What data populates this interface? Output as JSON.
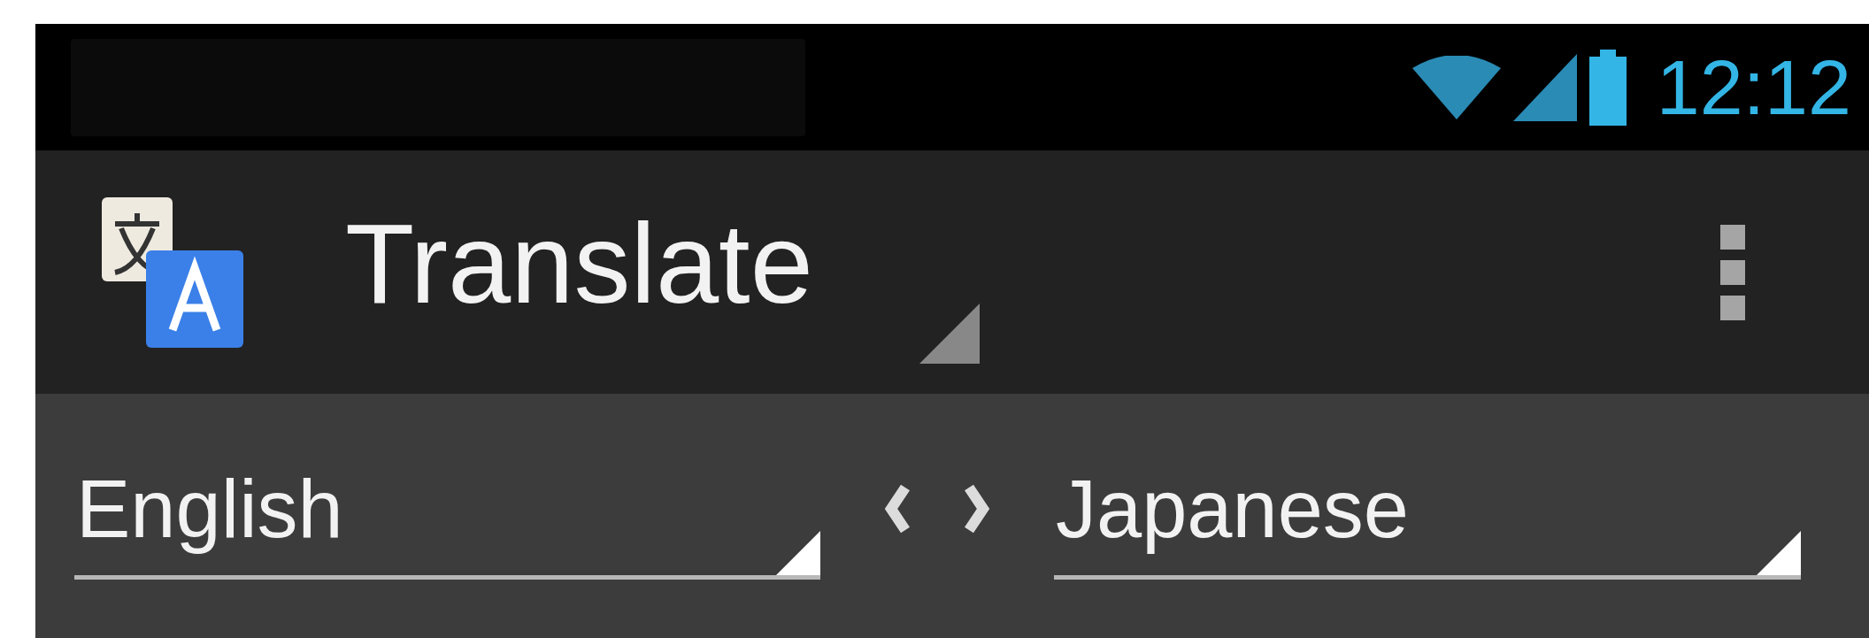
{
  "status_bar": {
    "time": "12:12"
  },
  "app_bar": {
    "title": "Translate"
  },
  "language_bar": {
    "source_language": "English",
    "target_language": "Japanese"
  }
}
